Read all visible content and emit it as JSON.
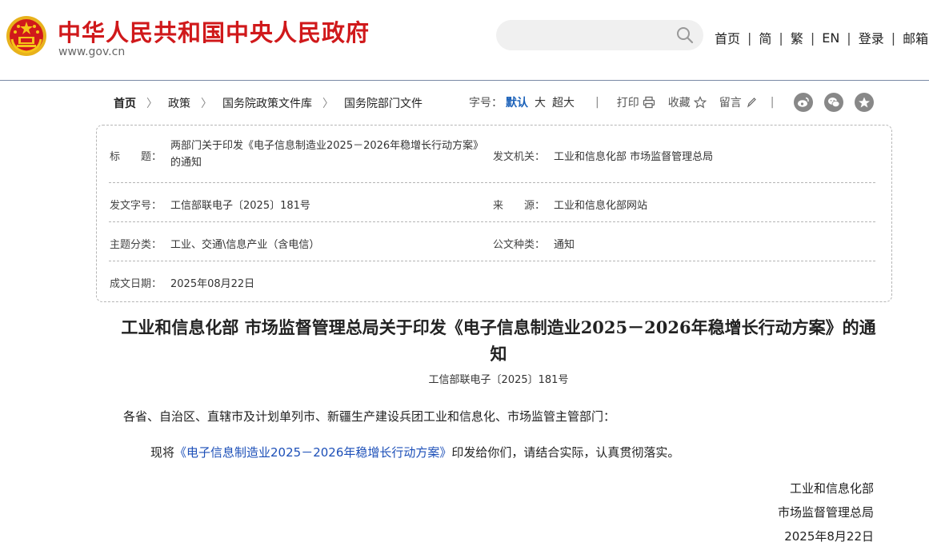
{
  "header": {
    "site_title": "中华人民共和国中央人民政府",
    "site_url": "www.gov.cn",
    "nav": [
      "首页",
      "简",
      "繁",
      "EN",
      "登录",
      "邮箱"
    ]
  },
  "breadcrumb": {
    "items": [
      "首页",
      "政策",
      "国务院政策文件库",
      "国务院部门文件"
    ]
  },
  "tools": {
    "font_size_label": "字号：",
    "font_default": "默认",
    "font_large": "大",
    "font_xlarge": "超大",
    "separator": "|",
    "print": "打印",
    "favorite": "收藏",
    "comment": "留言"
  },
  "info": {
    "title_label": "标　　题：",
    "title_value": "两部门关于印发《电子信息制造业2025－2026年稳增长行动方案》的通知",
    "issuer_label": "发文机关：",
    "issuer_value": "工业和信息化部 市场监督管理总局",
    "doc_no_label": "发文字号：",
    "doc_no_value": "工信部联电子〔2025〕181号",
    "source_label": "来　　源：",
    "source_value": "工业和信息化部网站",
    "topic_label": "主题分类：",
    "topic_value": "工业、交通\\信息产业（含电信）",
    "type_label": "公文种类：",
    "type_value": "通知",
    "date_label": "成文日期：",
    "date_value": "2025年08月22日"
  },
  "article": {
    "title": "工业和信息化部 市场监督管理总局关于印发《电子信息制造业2025－2026年稳增长行动方案》的通知",
    "doc_no": "工信部联电子〔2025〕181号",
    "salutation": "各省、自治区、直辖市及计划单列市、新疆生产建设兵团工业和信息化、市场监管主管部门：",
    "body_prefix": "现将",
    "body_link": "《电子信息制造业2025－2026年稳增长行动方案》",
    "body_suffix": "印发给你们，请结合实际，认真贯彻落实。",
    "signatory_1": "工业和信息化部",
    "signatory_2": "市场监督管理总局",
    "sign_date": "2025年8月22日"
  },
  "colors": {
    "brand_red": "#d0191b",
    "link_blue": "#1c4fb8",
    "accent_blue": "#1c62b9"
  },
  "icons": [
    "national-emblem-icon",
    "search-icon",
    "printer-icon",
    "star-icon",
    "pencil-icon",
    "weibo-icon",
    "wechat-icon",
    "qzone-icon"
  ]
}
